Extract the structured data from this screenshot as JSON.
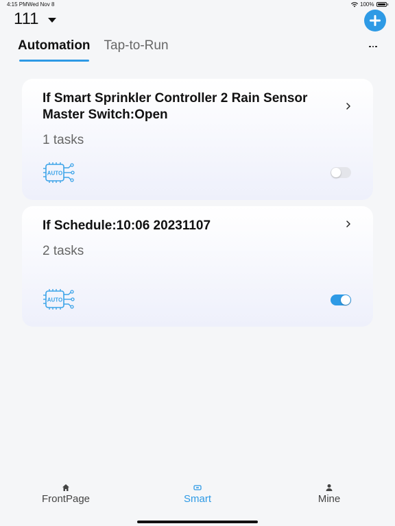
{
  "status_bar": {
    "time": "4:15 PM",
    "date": "Wed Nov 8",
    "battery": "100%"
  },
  "header": {
    "home_name": "111"
  },
  "tabs": [
    {
      "label": "Automation",
      "active": true
    },
    {
      "label": "Tap-to-Run",
      "active": false
    }
  ],
  "cards": [
    {
      "title": "If Smart Sprinkler Controller 2 Rain Sensor Master Switch:Open",
      "tasks": "1 tasks",
      "enabled": false
    },
    {
      "title": "If Schedule:10:06 20231107",
      "tasks": "2 tasks",
      "enabled": true
    }
  ],
  "icons": {
    "auto_badge_text": "AUTO"
  },
  "bottom_nav": {
    "frontpage": "FrontPage",
    "smart": "Smart",
    "mine": "Mine"
  },
  "colors": {
    "accent": "#2e9ae5",
    "toggle_off": "#e4e5ea",
    "background": "#f5f6f8"
  }
}
